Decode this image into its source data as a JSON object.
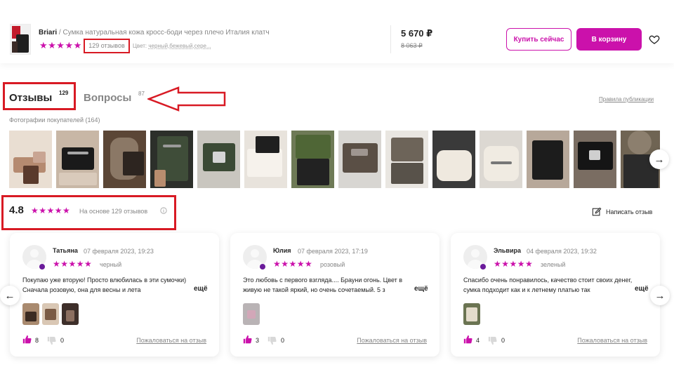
{
  "header": {
    "brand": "Briari",
    "separator": " / ",
    "product_title": "Сумка натуральная кожа кросс-боди через плечо Италия клатч",
    "stars": "★★★★★",
    "reviews_link": "129 отзывов",
    "color_label": "Цвет: ",
    "color_value": "черный,бежевый,сере...",
    "price": "5 670 ₽",
    "old_price": "8 063 ₽",
    "buy_now_label": "Купить сейчас",
    "add_to_cart_label": "В корзину",
    "favorite_icon": "heart-icon"
  },
  "tabs": {
    "reviews_label": "Отзывы",
    "reviews_count": "129",
    "questions_label": "Вопросы",
    "questions_count": "87",
    "rules_link": "Правила публикации"
  },
  "photos": {
    "label": "Фотографии покупателей (164)",
    "next_icon": "→"
  },
  "rating": {
    "value": "4.8",
    "stars": "★★★★★",
    "basis": "На основе 129 отзывов",
    "write_review_label": "Написать отзыв"
  },
  "reviews": [
    {
      "name": "Татьяна",
      "date": "07 февраля 2023, 19:23",
      "stars": "★★★★★",
      "color": "черный",
      "text": "Покупаю уже вторую! Просто влюбилась в эти сумочки) Сначала розовую, она для весны и лета",
      "more": "ещё",
      "likes": "8",
      "dislikes": "0",
      "complain": "Пожаловаться на отзыв"
    },
    {
      "name": "Юлия",
      "date": "07 февраля 2023, 17:19",
      "stars": "★★★★★",
      "color": "розовый",
      "text": "Это любовь с первого взгляда.... Брауни огонь. Цвет в живую не такой яркий, но очень сочетаемый. 5 з",
      "more": "ещё",
      "likes": "3",
      "dislikes": "0",
      "complain": "Пожаловаться на отзыв"
    },
    {
      "name": "Эльвира",
      "date": "04 февраля 2023, 19:32",
      "stars": "★★★★★",
      "color": "зеленый",
      "text": "Спасибо очень понравилось, качество стоит своих денег, сумка подходит как и к летнему платью так",
      "more": "ещё",
      "likes": "4",
      "dislikes": "0",
      "complain": "Пожаловаться на отзыв"
    }
  ],
  "carousel": {
    "prev_icon": "←",
    "next_icon": "→"
  },
  "colors": {
    "accent": "#cb11ab",
    "annotation_red": "#d81a24",
    "muted_text": "#868686"
  }
}
